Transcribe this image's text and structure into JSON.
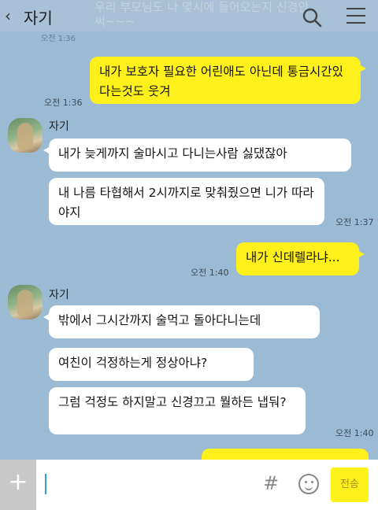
{
  "header": {
    "back_icon": "chevron-left-icon",
    "title": "자기",
    "preview_overlay": "우리 부모님도 나 몇시에 들어오는지 신경안써~~~",
    "search_icon": "search-icon",
    "menu_icon": "menu-icon"
  },
  "messages": [
    {
      "id": "m0",
      "direction": "out",
      "time": "오전 1:36",
      "text": "내가 보호자 필요한 어린애도 아닌데 통금시간있다는것도 웃겨"
    },
    {
      "id": "m1",
      "direction": "in",
      "sender": "자기",
      "text": "내가 늦게까지 술마시고 다니는사람 싫댔잖아"
    },
    {
      "id": "m2",
      "direction": "in",
      "time": "오전 1:37",
      "text": "내 나름 타협해서 2시까지로 맞춰줬으면 니가 따라야지"
    },
    {
      "id": "m3",
      "direction": "out",
      "time": "오전 1:40",
      "text": "내가 신데렐라냐..."
    },
    {
      "id": "m4",
      "direction": "in",
      "sender": "자기",
      "text": "밖에서 그시간까지 술먹고 돌아다니는데"
    },
    {
      "id": "m5",
      "direction": "in",
      "text": "여친이 걱정하는게 정상아냐?"
    },
    {
      "id": "m6",
      "direction": "in",
      "time": "오전 1:40",
      "text": "그럼 걱정도 하지말고 신경끄고 뭘하든 냅둬?"
    }
  ],
  "partial_time_top": "오전 1:36",
  "input_bar": {
    "plus_label": "+",
    "hash_label": "#",
    "emoji_icon": "emoji-icon",
    "send_label": "전송",
    "input_value": ""
  },
  "colors": {
    "background": "#9bbbd4",
    "outgoing_bubble": "#fef01b",
    "incoming_bubble": "#ffffff"
  }
}
